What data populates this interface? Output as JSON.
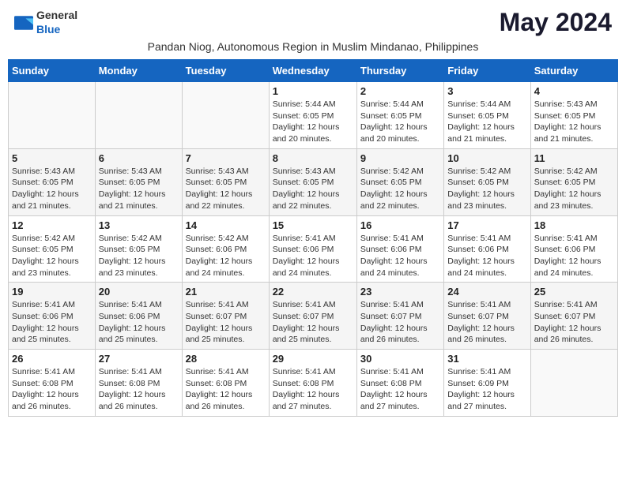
{
  "header": {
    "logo": {
      "general": "General",
      "blue": "Blue"
    },
    "title": "May 2024",
    "subtitle": "Pandan Niog, Autonomous Region in Muslim Mindanao, Philippines"
  },
  "weekdays": [
    "Sunday",
    "Monday",
    "Tuesday",
    "Wednesday",
    "Thursday",
    "Friday",
    "Saturday"
  ],
  "weeks": [
    [
      {
        "day": "",
        "info": ""
      },
      {
        "day": "",
        "info": ""
      },
      {
        "day": "",
        "info": ""
      },
      {
        "day": "1",
        "info": "Sunrise: 5:44 AM\nSunset: 6:05 PM\nDaylight: 12 hours\nand 20 minutes."
      },
      {
        "day": "2",
        "info": "Sunrise: 5:44 AM\nSunset: 6:05 PM\nDaylight: 12 hours\nand 20 minutes."
      },
      {
        "day": "3",
        "info": "Sunrise: 5:44 AM\nSunset: 6:05 PM\nDaylight: 12 hours\nand 21 minutes."
      },
      {
        "day": "4",
        "info": "Sunrise: 5:43 AM\nSunset: 6:05 PM\nDaylight: 12 hours\nand 21 minutes."
      }
    ],
    [
      {
        "day": "5",
        "info": "Sunrise: 5:43 AM\nSunset: 6:05 PM\nDaylight: 12 hours\nand 21 minutes."
      },
      {
        "day": "6",
        "info": "Sunrise: 5:43 AM\nSunset: 6:05 PM\nDaylight: 12 hours\nand 21 minutes."
      },
      {
        "day": "7",
        "info": "Sunrise: 5:43 AM\nSunset: 6:05 PM\nDaylight: 12 hours\nand 22 minutes."
      },
      {
        "day": "8",
        "info": "Sunrise: 5:43 AM\nSunset: 6:05 PM\nDaylight: 12 hours\nand 22 minutes."
      },
      {
        "day": "9",
        "info": "Sunrise: 5:42 AM\nSunset: 6:05 PM\nDaylight: 12 hours\nand 22 minutes."
      },
      {
        "day": "10",
        "info": "Sunrise: 5:42 AM\nSunset: 6:05 PM\nDaylight: 12 hours\nand 23 minutes."
      },
      {
        "day": "11",
        "info": "Sunrise: 5:42 AM\nSunset: 6:05 PM\nDaylight: 12 hours\nand 23 minutes."
      }
    ],
    [
      {
        "day": "12",
        "info": "Sunrise: 5:42 AM\nSunset: 6:05 PM\nDaylight: 12 hours\nand 23 minutes."
      },
      {
        "day": "13",
        "info": "Sunrise: 5:42 AM\nSunset: 6:05 PM\nDaylight: 12 hours\nand 23 minutes."
      },
      {
        "day": "14",
        "info": "Sunrise: 5:42 AM\nSunset: 6:06 PM\nDaylight: 12 hours\nand 24 minutes."
      },
      {
        "day": "15",
        "info": "Sunrise: 5:41 AM\nSunset: 6:06 PM\nDaylight: 12 hours\nand 24 minutes."
      },
      {
        "day": "16",
        "info": "Sunrise: 5:41 AM\nSunset: 6:06 PM\nDaylight: 12 hours\nand 24 minutes."
      },
      {
        "day": "17",
        "info": "Sunrise: 5:41 AM\nSunset: 6:06 PM\nDaylight: 12 hours\nand 24 minutes."
      },
      {
        "day": "18",
        "info": "Sunrise: 5:41 AM\nSunset: 6:06 PM\nDaylight: 12 hours\nand 24 minutes."
      }
    ],
    [
      {
        "day": "19",
        "info": "Sunrise: 5:41 AM\nSunset: 6:06 PM\nDaylight: 12 hours\nand 25 minutes."
      },
      {
        "day": "20",
        "info": "Sunrise: 5:41 AM\nSunset: 6:06 PM\nDaylight: 12 hours\nand 25 minutes."
      },
      {
        "day": "21",
        "info": "Sunrise: 5:41 AM\nSunset: 6:07 PM\nDaylight: 12 hours\nand 25 minutes."
      },
      {
        "day": "22",
        "info": "Sunrise: 5:41 AM\nSunset: 6:07 PM\nDaylight: 12 hours\nand 25 minutes."
      },
      {
        "day": "23",
        "info": "Sunrise: 5:41 AM\nSunset: 6:07 PM\nDaylight: 12 hours\nand 26 minutes."
      },
      {
        "day": "24",
        "info": "Sunrise: 5:41 AM\nSunset: 6:07 PM\nDaylight: 12 hours\nand 26 minutes."
      },
      {
        "day": "25",
        "info": "Sunrise: 5:41 AM\nSunset: 6:07 PM\nDaylight: 12 hours\nand 26 minutes."
      }
    ],
    [
      {
        "day": "26",
        "info": "Sunrise: 5:41 AM\nSunset: 6:08 PM\nDaylight: 12 hours\nand 26 minutes."
      },
      {
        "day": "27",
        "info": "Sunrise: 5:41 AM\nSunset: 6:08 PM\nDaylight: 12 hours\nand 26 minutes."
      },
      {
        "day": "28",
        "info": "Sunrise: 5:41 AM\nSunset: 6:08 PM\nDaylight: 12 hours\nand 26 minutes."
      },
      {
        "day": "29",
        "info": "Sunrise: 5:41 AM\nSunset: 6:08 PM\nDaylight: 12 hours\nand 27 minutes."
      },
      {
        "day": "30",
        "info": "Sunrise: 5:41 AM\nSunset: 6:08 PM\nDaylight: 12 hours\nand 27 minutes."
      },
      {
        "day": "31",
        "info": "Sunrise: 5:41 AM\nSunset: 6:09 PM\nDaylight: 12 hours\nand 27 minutes."
      },
      {
        "day": "",
        "info": ""
      }
    ]
  ]
}
